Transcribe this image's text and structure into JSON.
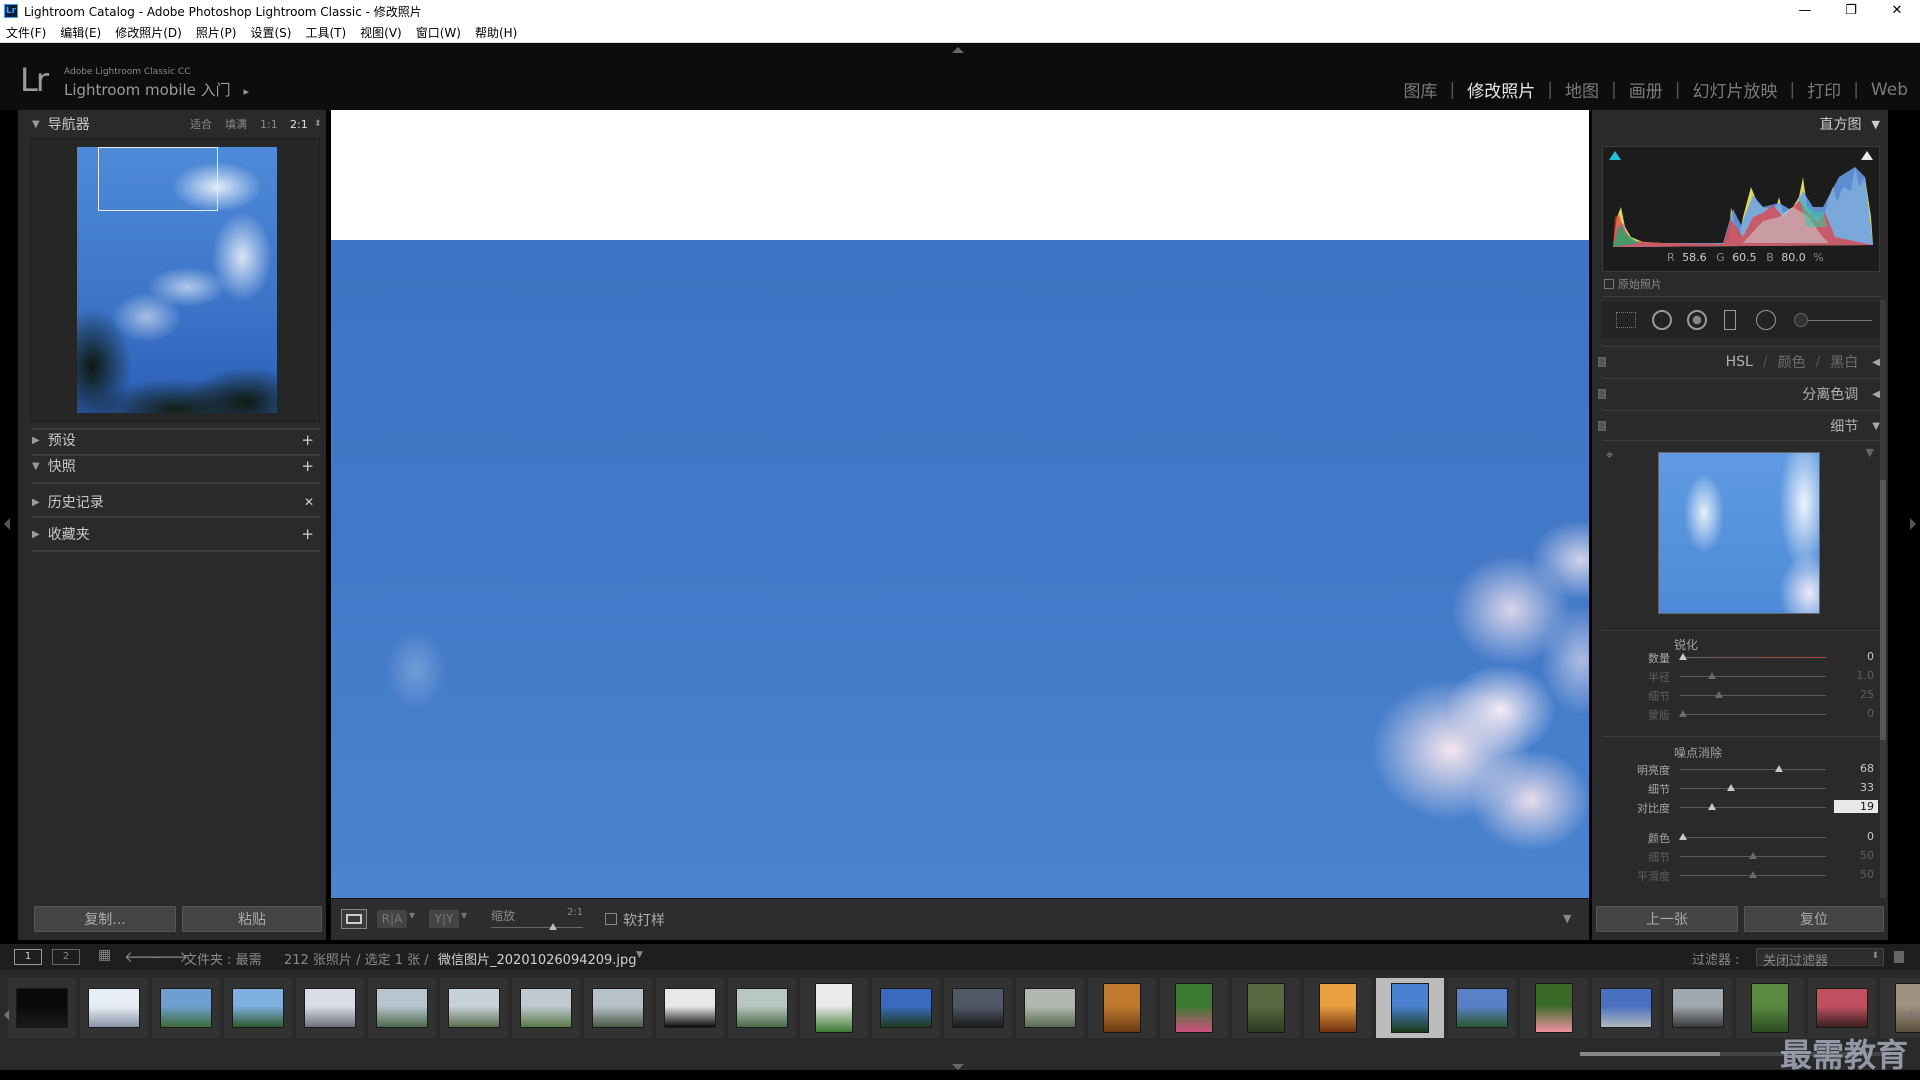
{
  "window": {
    "title": "Lightroom Catalog - Adobe Photoshop Lightroom Classic - 修改照片",
    "app_icon": "Lr",
    "min": "—",
    "restore": "❐",
    "close": "✕"
  },
  "menu": [
    "文件(F)",
    "编辑(E)",
    "修改照片(D)",
    "照片(P)",
    "设置(S)",
    "工具(T)",
    "视图(V)",
    "窗口(W)",
    "帮助(H)"
  ],
  "identity": {
    "logo": "Lr",
    "line1": "Adobe Lightroom Classic CC",
    "line2": "Lightroom mobile 入门",
    "arrow": "▸"
  },
  "modules": [
    "图库",
    "修改照片",
    "地图",
    "画册",
    "幻灯片放映",
    "打印",
    "Web"
  ],
  "active_module": "修改照片",
  "navigator": {
    "title": "导航器",
    "fit": "适合",
    "fill": "填满",
    "one": "1:1",
    "zoom": "2:1"
  },
  "left_sections": [
    {
      "label": "预设",
      "action": "+"
    },
    {
      "label": "快照",
      "action": "+"
    },
    {
      "label": "历史记录",
      "action": "✕"
    },
    {
      "label": "收藏夹",
      "action": "+"
    }
  ],
  "left_buttons": {
    "copy": "复制...",
    "paste": "粘贴"
  },
  "toolbar": {
    "zoom_label": "缩放",
    "zoom_value": "2:1",
    "soft_proof": "软打样",
    "ra": "R|A",
    "yy": "Y|Y"
  },
  "histogram": {
    "title": "直方图",
    "r_label": "R",
    "r_value": "58.6",
    "g_label": "G",
    "g_value": "60.5",
    "b_label": "B",
    "b_value": "80.0",
    "unit": "%",
    "original": "原始照片"
  },
  "right_sections": {
    "hsl": "HSL",
    "color": "颜色",
    "bw": "黑白",
    "split": "分离色调",
    "detail": "细节"
  },
  "sharpen": {
    "title": "锐化",
    "rows": [
      {
        "label": "数量",
        "value": "0",
        "pos": 0.02
      },
      {
        "label": "半径",
        "value": "1.0",
        "pos": 0.22
      },
      {
        "label": "细节",
        "value": "25",
        "pos": 0.27
      },
      {
        "label": "蒙版",
        "value": "0",
        "pos": 0.02
      }
    ]
  },
  "noise": {
    "title": "噪点消除",
    "rows": [
      {
        "label": "明亮度",
        "value": "68",
        "pos": 0.68
      },
      {
        "label": "细节",
        "value": "33",
        "pos": 0.35
      },
      {
        "label": "对比度",
        "value": "19",
        "pos": 0.22
      }
    ],
    "color_rows": [
      {
        "label": "颜色",
        "value": "0",
        "pos": 0.02
      },
      {
        "label": "细节",
        "value": "50",
        "pos": 0.5
      },
      {
        "label": "平滑度",
        "value": "50",
        "pos": 0.5
      }
    ]
  },
  "right_buttons": {
    "prev": "上一张",
    "reset": "复位"
  },
  "filmstrip_header": {
    "view1": "1",
    "view2": "2",
    "source": "文件夹 : 最需",
    "count": "212 张照片 / 选定 1 张 /",
    "filename": "微信图片_20201026094209.jpg",
    "filter_label": "过滤器 :",
    "filter_value": "关闭过滤器"
  },
  "watermark": "最需教育",
  "thumbs": [
    {
      "c1": "#0a0a0a",
      "c2": "#1a1a1a"
    },
    {
      "c1": "#e8eef5",
      "c2": "#8a95a8"
    },
    {
      "c1": "#6e9fd0",
      "c2": "#3d6b3a"
    },
    {
      "c1": "#7fb0e0",
      "c2": "#2f5a30"
    },
    {
      "c1": "#d8dde8",
      "c2": "#70707a"
    },
    {
      "c1": "#b8c4d0",
      "c2": "#4c6a4a"
    },
    {
      "c1": "#c8d0d8",
      "c2": "#5a7050"
    },
    {
      "c1": "#c0c8d0",
      "c2": "#5a7a48"
    },
    {
      "c1": "#b8c0c8",
      "c2": "#4a5a48"
    },
    {
      "c1": "#e8e8e8",
      "c2": "#0a0a0a"
    },
    {
      "c1": "#b8c8c0",
      "c2": "#4a6a48"
    },
    {
      "c1": "#eaeaea",
      "c2": "#3a7a30"
    },
    {
      "c1": "#3a6ac0",
      "c2": "#203a20"
    },
    {
      "c1": "#505868",
      "c2": "#1a1a1a"
    },
    {
      "c1": "#b0b8b0",
      "c2": "#5a6a50"
    },
    {
      "c1": "#c07a30",
      "c2": "#6a3a10"
    },
    {
      "c1": "#3a7a30",
      "c2": "#d05080"
    },
    {
      "c1": "#5a6a40",
      "c2": "#2a3a20"
    },
    {
      "c1": "#e8a040",
      "c2": "#703010"
    },
    {
      "c1": "#4a80d0",
      "c2": "#1a3a1a"
    },
    {
      "c1": "#5a80c8",
      "c2": "#2a5a30"
    },
    {
      "c1": "#3a6a28",
      "c2": "#f090a0"
    },
    {
      "c1": "#4a70c0",
      "c2": "#b0b8c0"
    },
    {
      "c1": "#a0a8b0",
      "c2": "#3a3a3a"
    },
    {
      "c1": "#5a8a40",
      "c2": "#2a4a20"
    },
    {
      "c1": "#c05060",
      "c2": "#3a2020"
    },
    {
      "c1": "#a09080",
      "c2": "#5a5040"
    }
  ]
}
